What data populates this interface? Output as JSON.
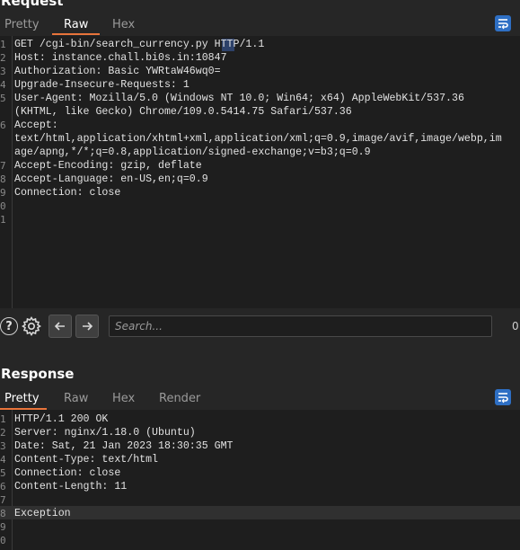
{
  "request": {
    "title": "Request",
    "tabs": [
      "Pretty",
      "Raw",
      "Hex"
    ],
    "active_tab": "Raw",
    "lines": [
      {
        "n": "1",
        "text": "GET /cgi-bin/search_currency.py HTTP/1.1"
      },
      {
        "n": "2",
        "text": "Host: instance.chall.bi0s.in:10847"
      },
      {
        "n": "3",
        "text": "Authorization: Basic YWRtaW46wq0="
      },
      {
        "n": "4",
        "text": "Upgrade-Insecure-Requests: 1"
      },
      {
        "n": "5",
        "text": "User-Agent: Mozilla/5.0 (Windows NT 10.0; Win64; x64) AppleWebKit/537.36"
      },
      {
        "n": "",
        "text": "(KHTML, like Gecko) Chrome/109.0.5414.75 Safari/537.36"
      },
      {
        "n": "6",
        "text": "Accept:"
      },
      {
        "n": "",
        "text": "text/html,application/xhtml+xml,application/xml;q=0.9,image/avif,image/webp,im"
      },
      {
        "n": "",
        "text": "age/apng,*/*;q=0.8,application/signed-exchange;v=b3;q=0.9"
      },
      {
        "n": "7",
        "text": "Accept-Encoding: gzip, deflate"
      },
      {
        "n": "8",
        "text": "Accept-Language: en-US,en;q=0.9"
      },
      {
        "n": "9",
        "text": "Connection: close"
      },
      {
        "n": "0",
        "text": ""
      },
      {
        "n": "1",
        "text": ""
      }
    ],
    "search_placeholder": "Search...",
    "match_count": "0"
  },
  "response": {
    "title": "Response",
    "tabs": [
      "Pretty",
      "Raw",
      "Hex",
      "Render"
    ],
    "active_tab": "Pretty",
    "lines": [
      {
        "n": "1",
        "text": "HTTP/1.1 200 OK"
      },
      {
        "n": "2",
        "text": "Server: nginx/1.18.0 (Ubuntu)"
      },
      {
        "n": "3",
        "text": "Date: Sat, 21 Jan 2023 18:30:35 GMT"
      },
      {
        "n": "4",
        "text": "Content-Type: text/html"
      },
      {
        "n": "5",
        "text": "Connection: close"
      },
      {
        "n": "6",
        "text": "Content-Length: 11"
      },
      {
        "n": "7",
        "text": ""
      },
      {
        "n": "8",
        "text": "Exception"
      },
      {
        "n": "9",
        "text": ""
      },
      {
        "n": "0",
        "text": ""
      }
    ]
  },
  "icons": {
    "help": "help-icon",
    "settings": "gear-icon",
    "back": "arrow-left-icon",
    "forward": "arrow-right-icon",
    "wrap": "text-wrap-icon"
  },
  "colors": {
    "accent_tab": "#e8743b",
    "wrap_button": "#2e6fc4",
    "background": "#262626",
    "editor": "#1e1e1e"
  }
}
